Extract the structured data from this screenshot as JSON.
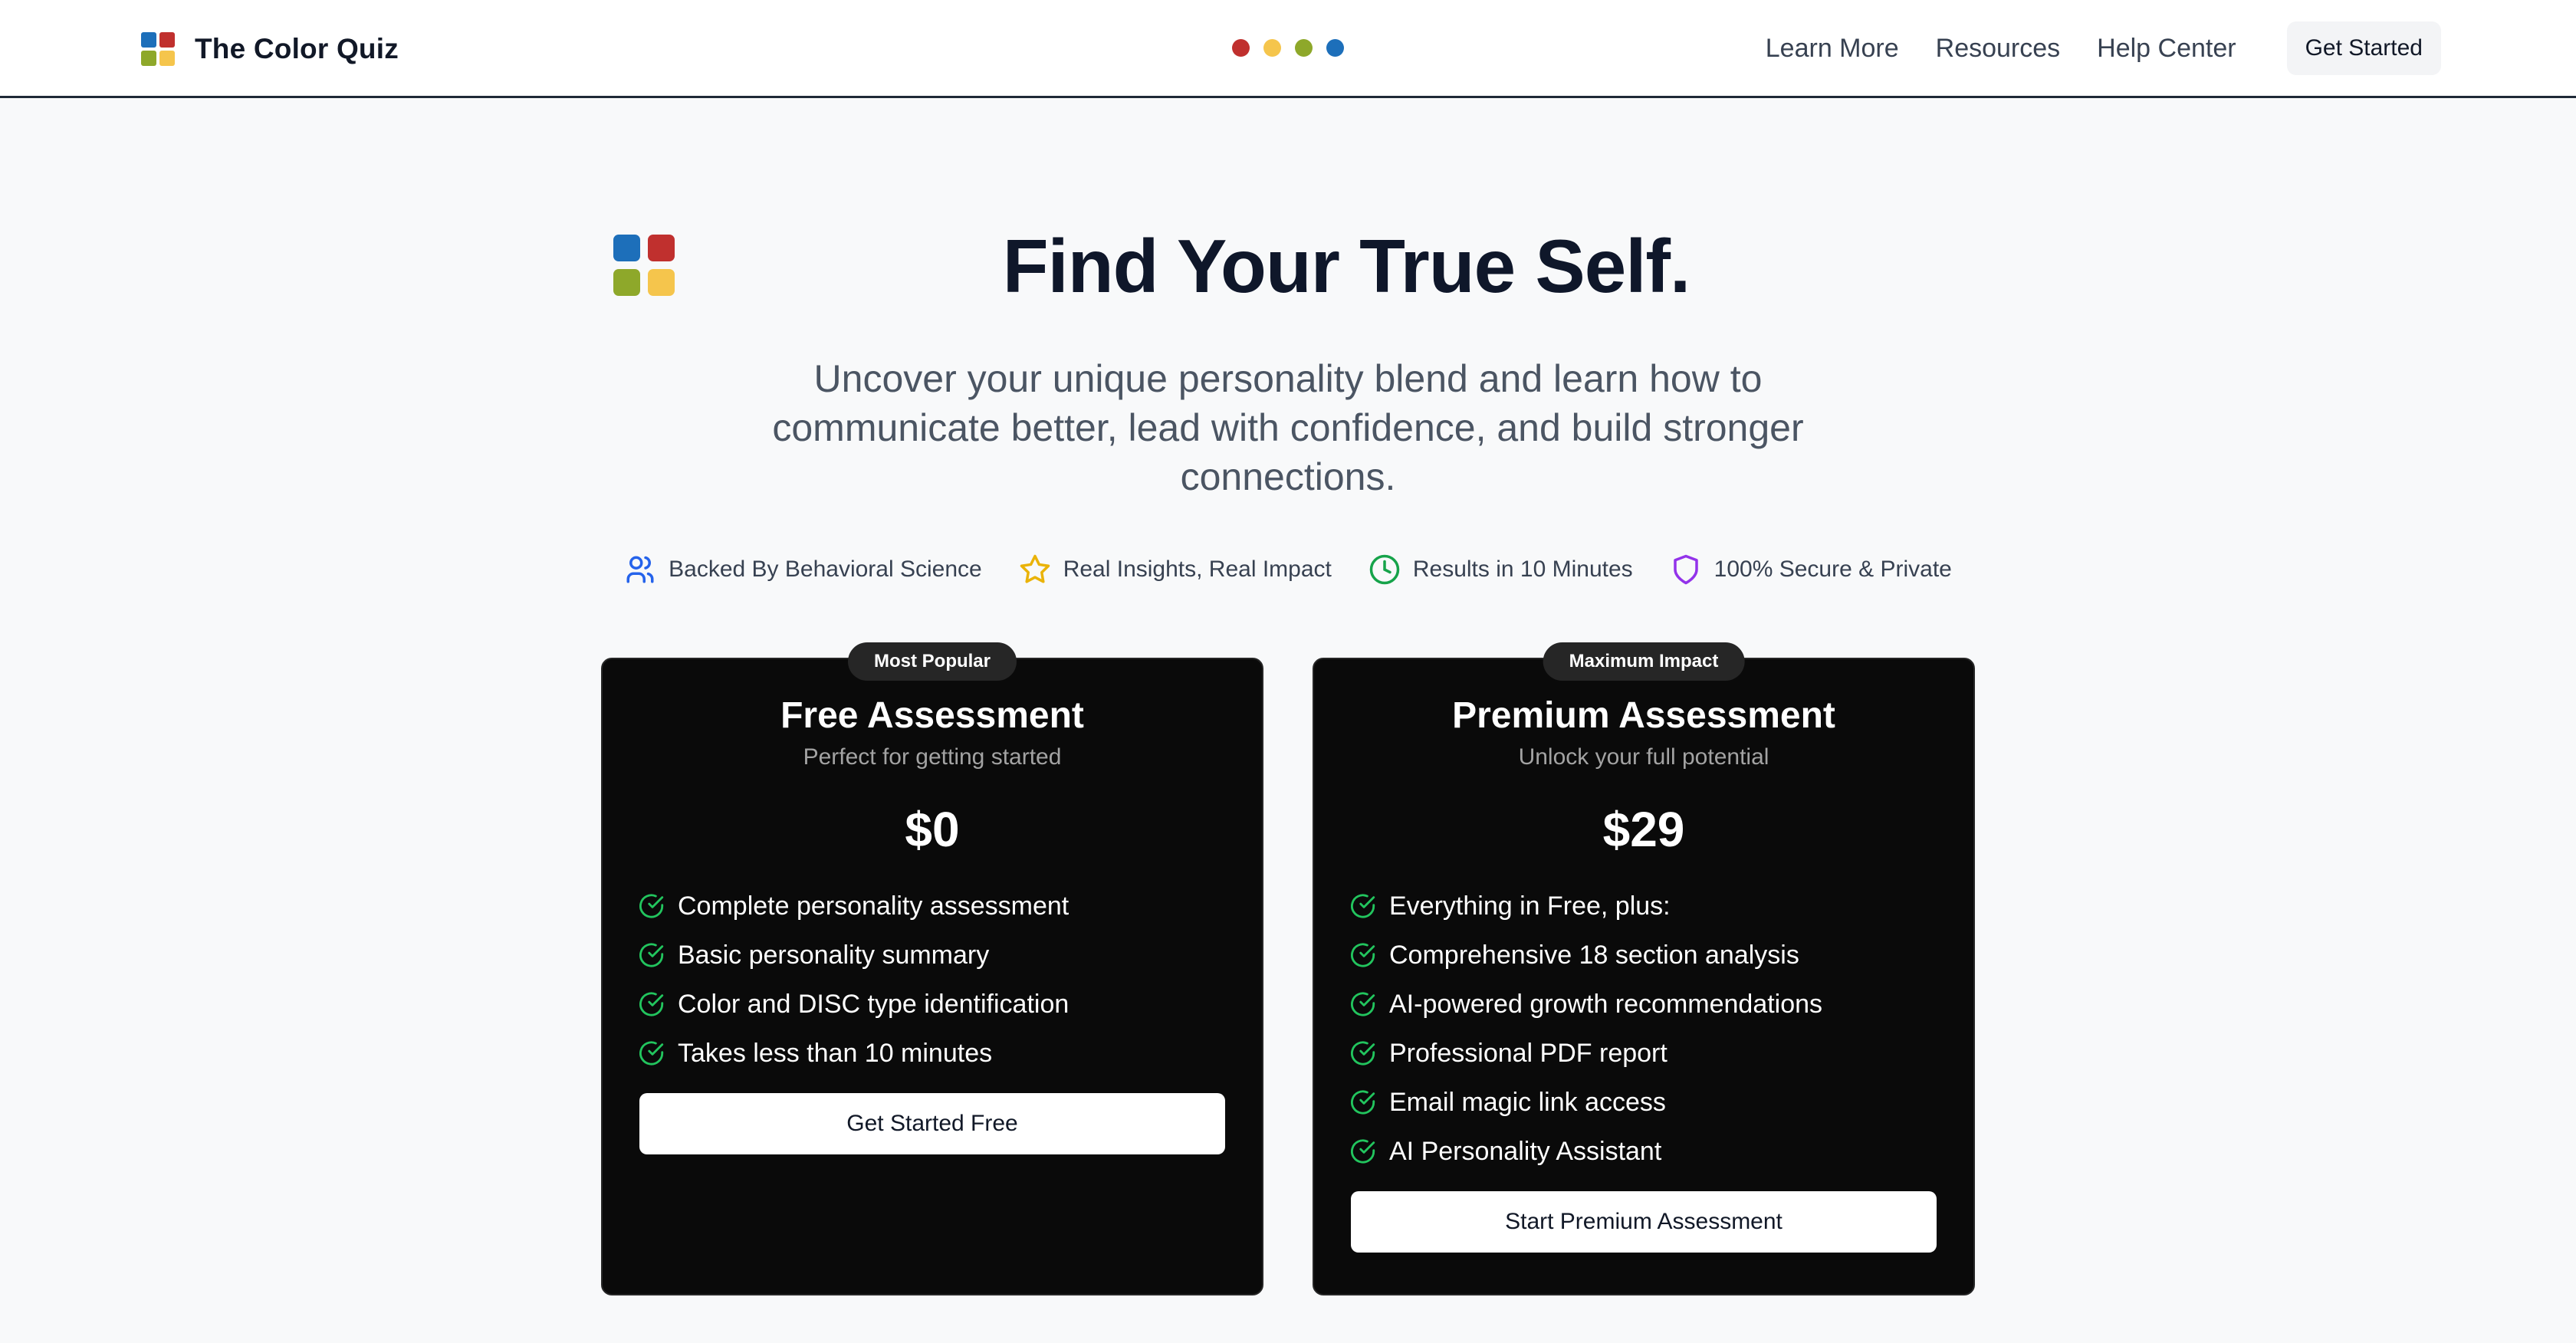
{
  "header": {
    "brand": "The Color Quiz",
    "logo_colors": [
      "#1d6fba",
      "#c0302e",
      "#8ea82a",
      "#f5c54c"
    ],
    "step_dots": [
      "#c0302e",
      "#f5c54c",
      "#8ea82a",
      "#1d6fba"
    ],
    "nav": [
      "Learn More",
      "Resources",
      "Help Center"
    ],
    "cta": "Get Started"
  },
  "hero": {
    "title": "Find Your True Self.",
    "subtitle": "Uncover your unique personality blend and learn how to communicate better, lead with confidence, and build stronger connections.",
    "logo_colors": [
      "#1d6fba",
      "#c0302e",
      "#8ea82a",
      "#f5c54c"
    ],
    "features": [
      {
        "icon": "users-icon",
        "label": "Backed By Behavioral Science",
        "color": "#2563eb"
      },
      {
        "icon": "star-icon",
        "label": "Real Insights, Real Impact",
        "color": "#eab308"
      },
      {
        "icon": "clock-icon",
        "label": "Results in 10 Minutes",
        "color": "#16a34a"
      },
      {
        "icon": "shield-icon",
        "label": "100% Secure & Private",
        "color": "#9333ea"
      }
    ]
  },
  "plans": [
    {
      "badge": "Most Popular",
      "title": "Free Assessment",
      "subtitle": "Perfect for getting started",
      "price": "$0",
      "features": [
        "Complete personality assessment",
        "Basic personality summary",
        "Color and DISC type identification",
        "Takes less than 10 minutes"
      ],
      "button": "Get Started Free"
    },
    {
      "badge": "Maximum Impact",
      "title": "Premium Assessment",
      "subtitle": "Unlock your full potential",
      "price": "$29",
      "features": [
        "Everything in Free, plus:",
        "Comprehensive 18 section analysis",
        "AI-powered growth recommendations",
        "Professional PDF report",
        "Email magic link access",
        "AI Personality Assistant"
      ],
      "button": "Start Premium Assessment"
    }
  ],
  "colors": {
    "check": "#22c55e",
    "card_bg": "#0a0a0a",
    "page_bg": "#f8f9fa"
  }
}
